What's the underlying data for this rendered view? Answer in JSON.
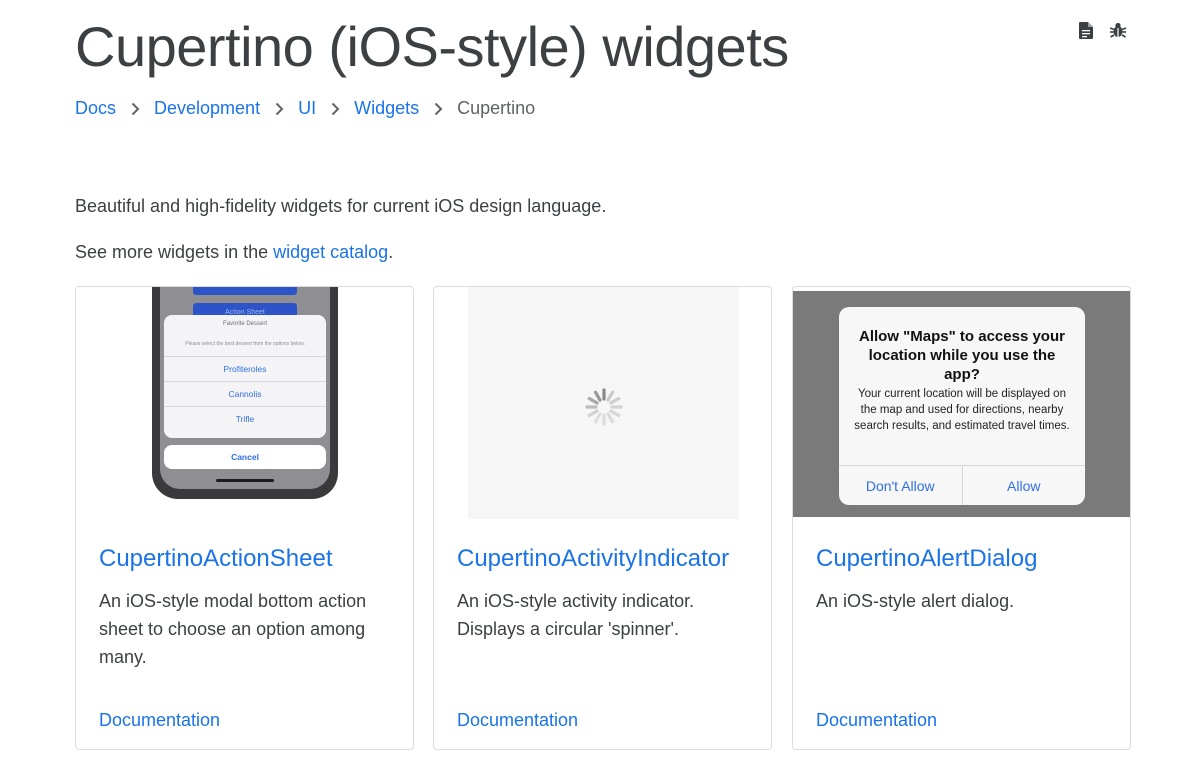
{
  "page": {
    "title": "Cupertino (iOS-style) widgets",
    "icons": [
      "document-icon",
      "bug-icon"
    ]
  },
  "breadcrumb": [
    {
      "label": "Docs",
      "link": true
    },
    {
      "label": "Development",
      "link": true
    },
    {
      "label": "UI",
      "link": true
    },
    {
      "label": "Widgets",
      "link": true
    },
    {
      "label": "Cupertino",
      "link": false
    }
  ],
  "intro": {
    "text": "Beautiful and high-fidelity widgets for current iOS design language.",
    "catalog_prefix": "See more widgets in the ",
    "catalog_link": "widget catalog",
    "catalog_suffix": "."
  },
  "cards": [
    {
      "title": "CupertinoActionSheet",
      "description": "An iOS-style modal bottom action sheet to choose an option among many.",
      "doc_label": "Documentation",
      "preview": {
        "button_label": "Action Sheet",
        "sheet_title": "Favorite Dessert",
        "sheet_message": "Please select the best dessert from the options below.",
        "options": [
          "Profiteroles",
          "Cannolis",
          "Trifle"
        ],
        "cancel": "Cancel"
      }
    },
    {
      "title": "CupertinoActivityIndicator",
      "description": "An iOS-style activity indicator. Displays a circular 'spinner'.",
      "doc_label": "Documentation"
    },
    {
      "title": "CupertinoAlertDialog",
      "description": "An iOS-style alert dialog.",
      "doc_label": "Documentation",
      "preview": {
        "alert_title": "Allow \"Maps\" to access your location while you use the app?",
        "alert_message": "Your current location will be displayed on the map and used for directions, nearby search results, and estimated travel times.",
        "actions": [
          "Don't Allow",
          "Allow"
        ]
      }
    }
  ],
  "colors": {
    "link": "#1a73e8",
    "ios_blue": "#2f6fe4",
    "text": "#3c4043"
  }
}
